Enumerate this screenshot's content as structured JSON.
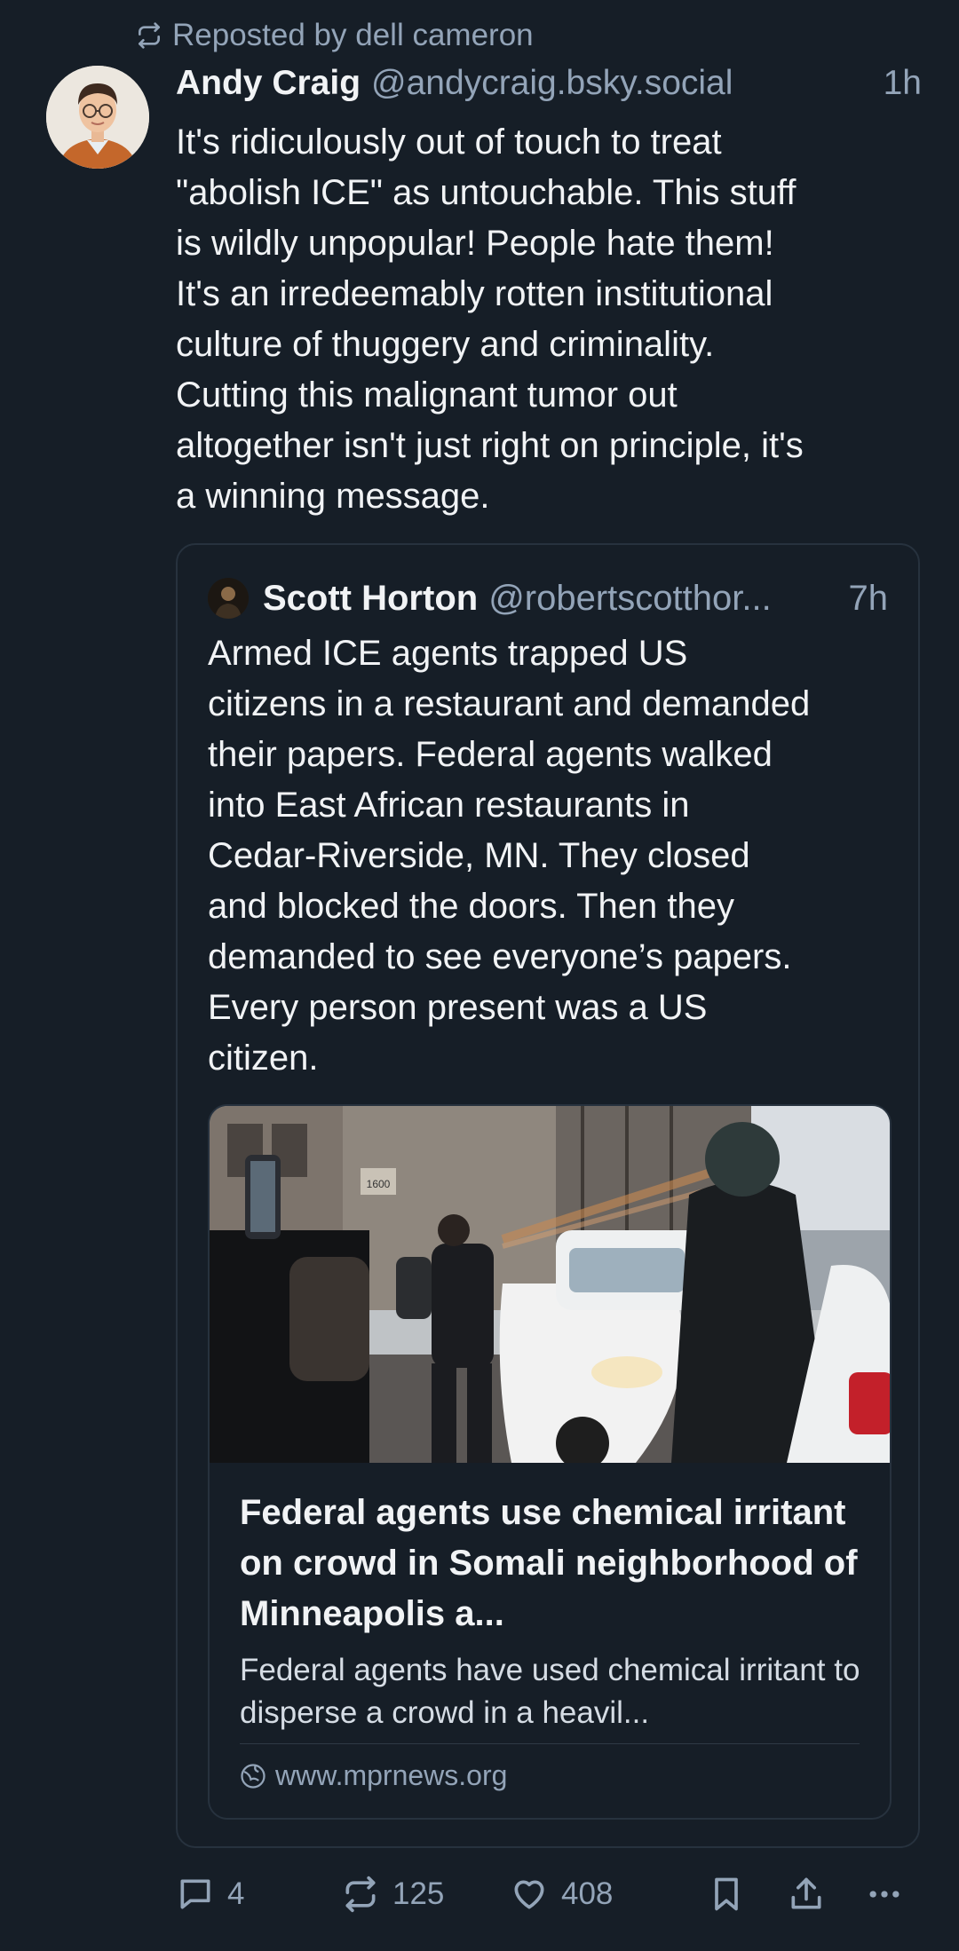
{
  "repost": {
    "text": "Reposted by dell cameron"
  },
  "post": {
    "author_name": "Andy Craig",
    "author_handle": "@andycraig.bsky.social",
    "time": "1h",
    "text": "It's ridiculously out of touch to treat\n\"abolish ICE\" as untouchable. This stuff\nis wildly unpopular! People hate them!\nIt's an irredeemably rotten institutional\nculture of thuggery and criminality.\nCutting this malignant tumor out\naltogether isn't just right on principle, it's\na winning message."
  },
  "quote": {
    "author_name": "Scott Horton",
    "author_handle": "@robertscotthor...",
    "time": "7h",
    "text": "Armed ICE agents trapped US\ncitizens in a restaurant and demanded\ntheir papers. Federal agents walked\ninto East African restaurants in\nCedar-Riverside, MN. They closed\nand blocked the doors. Then they\ndemanded to see everyone’s papers.\nEvery person present was a US\ncitizen."
  },
  "link_card": {
    "image_sign": "1600",
    "title": "Federal agents use chemical irritant on crowd in Somali neighborhood of Minneapolis a...",
    "description": "Federal agents have used chemical irritant to disperse a crowd in a heavil...",
    "domain": "www.mprnews.org"
  },
  "actions": {
    "replies": "4",
    "reposts": "125",
    "likes": "408"
  },
  "icons": {
    "repost": "repost-icon",
    "reply": "reply-icon",
    "like": "heart-icon",
    "bookmark": "bookmark-icon",
    "share": "share-icon",
    "more": "more-icon",
    "globe": "globe-icon"
  },
  "colors": {
    "background": "#161e27",
    "muted_text": "#93a4b8",
    "border": "#27323e"
  }
}
